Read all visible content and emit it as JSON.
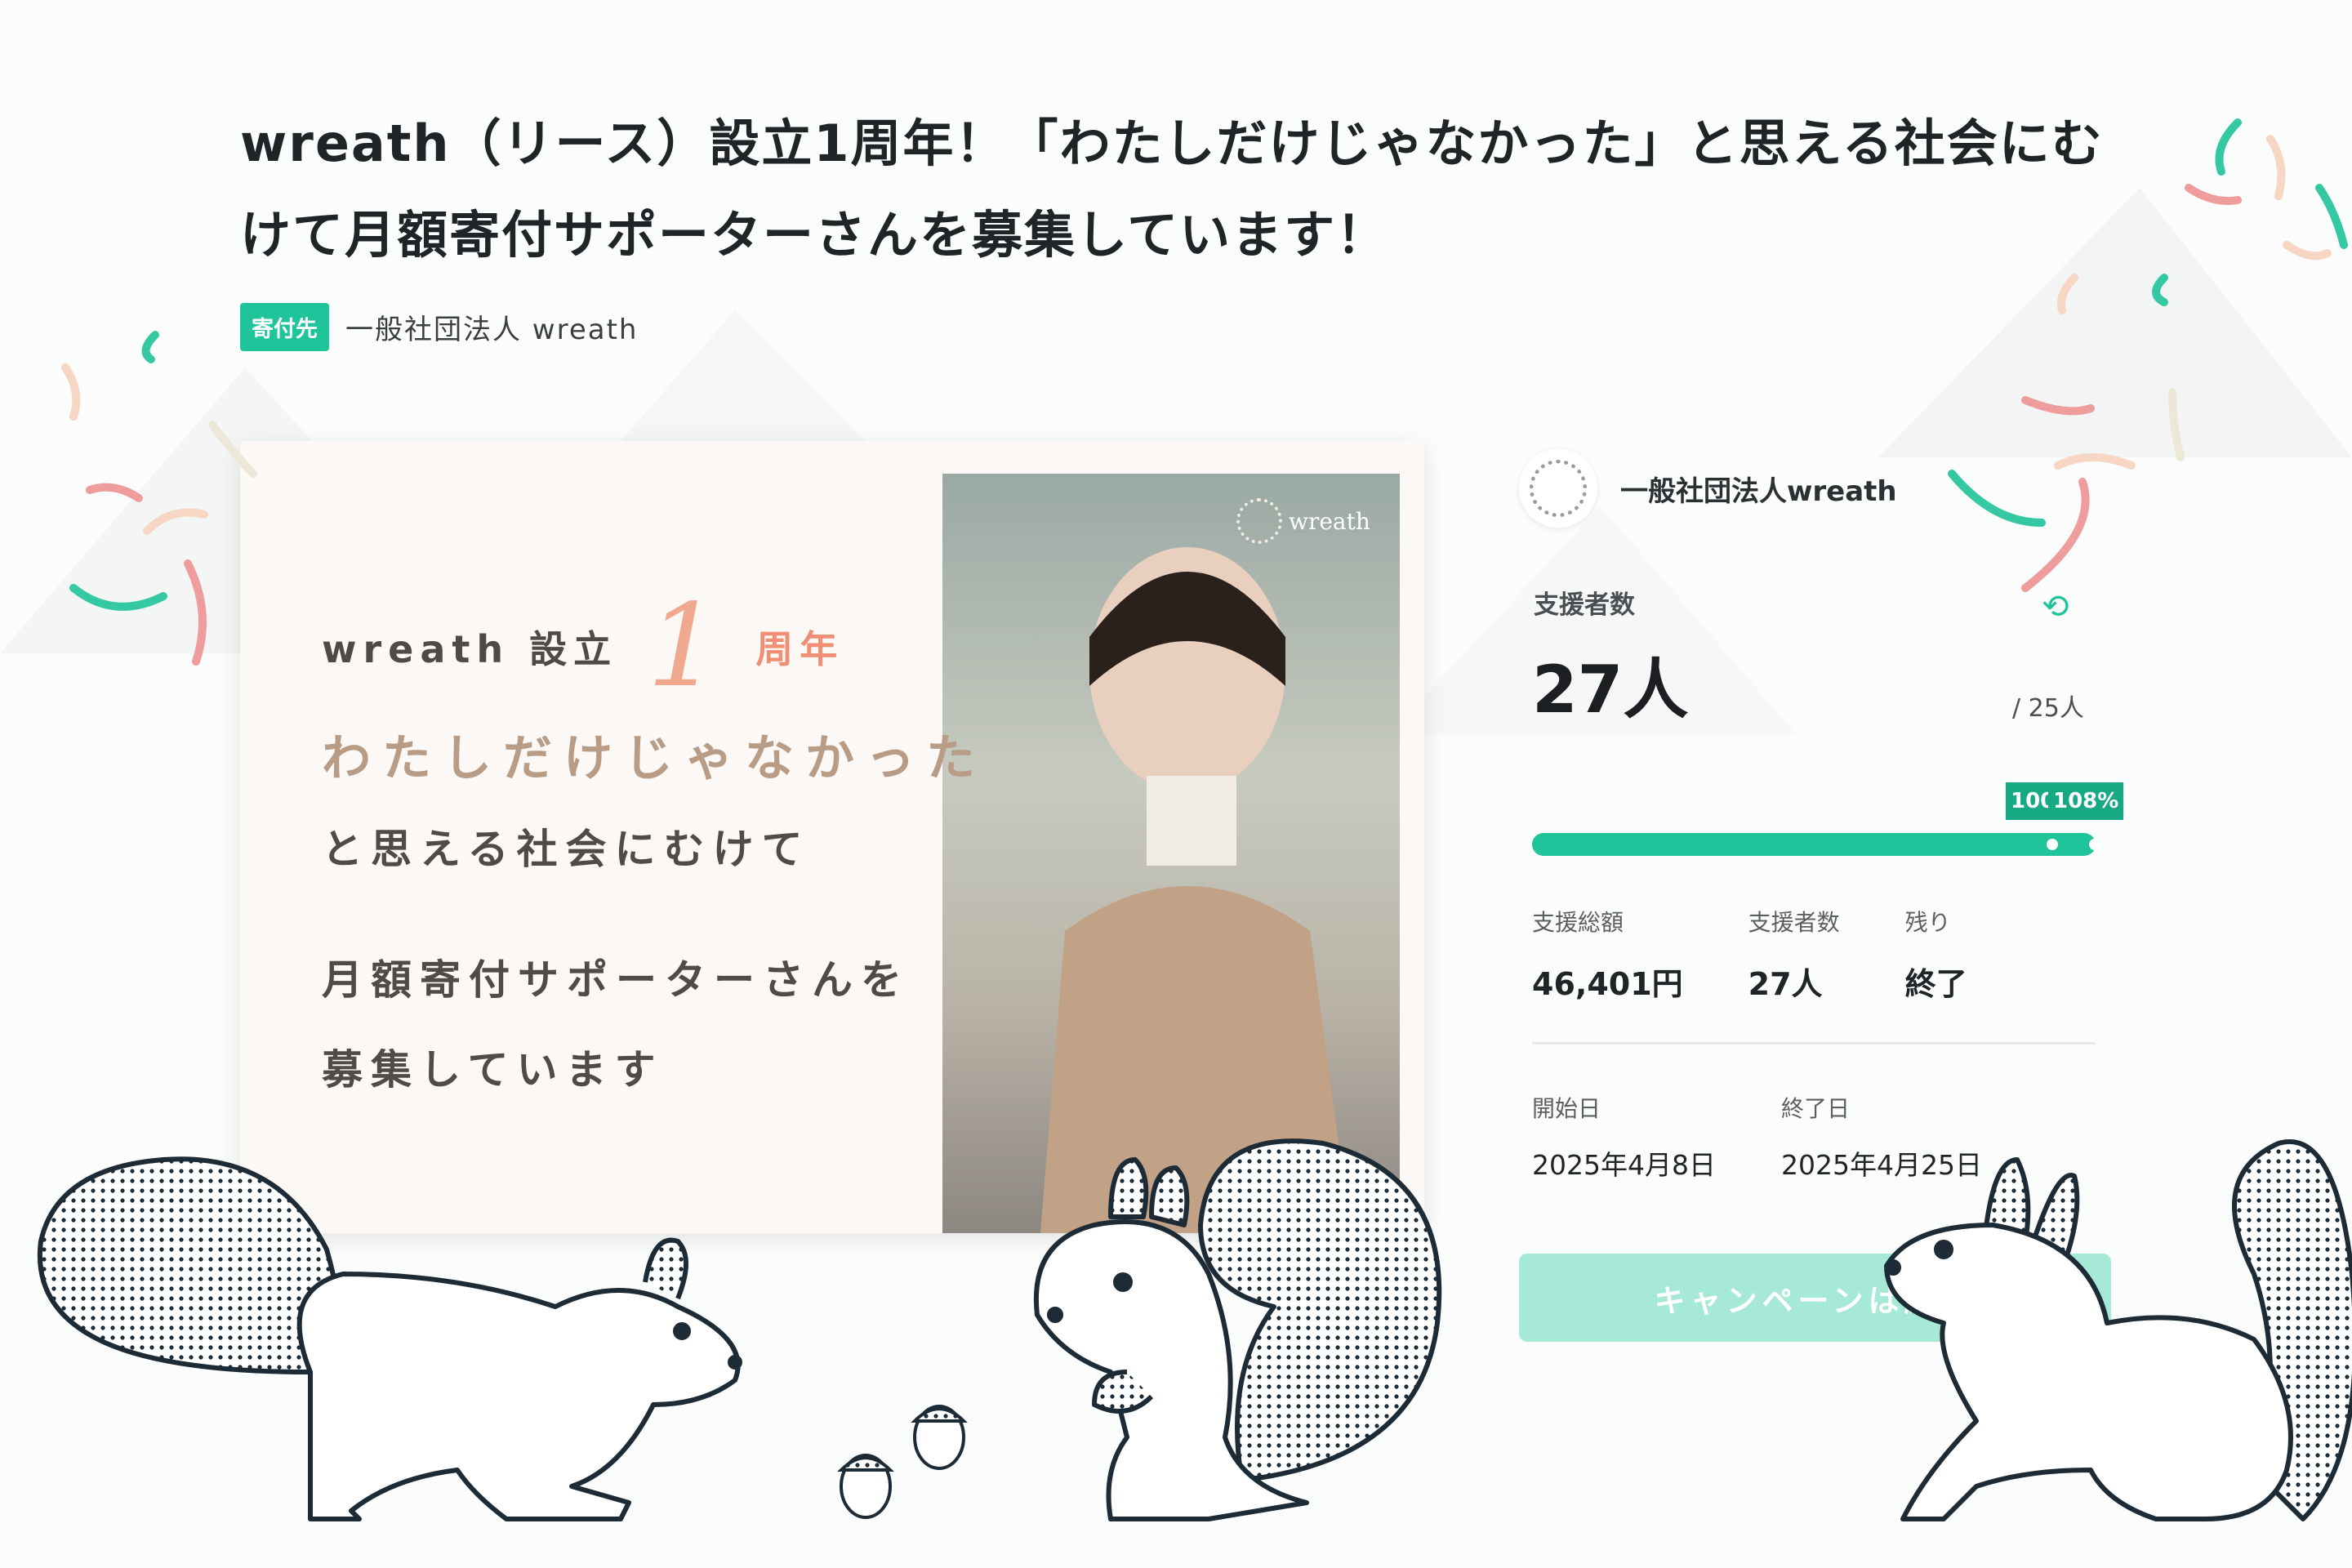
{
  "campaign": {
    "title": "wreath（リース）設立1周年！「わたしだけじゃなかった」と思える社会にむけて月額寄付サポーターさんを募集しています！",
    "recipient_tag": "寄付先",
    "recipient_name": "一般社団法人 wreath"
  },
  "image_card": {
    "brand": "wreath",
    "line1_prefix": "wreath 設立",
    "line1_number": "1",
    "line1_suffix": "周年",
    "line2": "わたしだけじゃなかった",
    "line3": "と思える社会にむけて",
    "line4": "月額寄付サポーターさんを",
    "line5": "募集しています"
  },
  "panel": {
    "org_name": "一般社団法人wreath",
    "supporters_label": "支援者数",
    "supporters_count": "27人",
    "goal": "/ 25人",
    "progress_percent": 108,
    "progress_badge_100": "100",
    "progress_badge": "108%",
    "stats": [
      {
        "label": "支援総額",
        "value": "46,401円"
      },
      {
        "label": "支援者数",
        "value": "27人"
      },
      {
        "label": "残り",
        "value": "終了"
      }
    ],
    "dates": [
      {
        "label": "開始日",
        "value": "2025年4月8日"
      },
      {
        "label": "終了日",
        "value": "2025年4月25日"
      }
    ],
    "end_button": "キャンペーンは終了"
  },
  "colors": {
    "accent": "#1fc49b",
    "accent_dark": "#17a984",
    "button_disabled": "#a6e9d6",
    "peach": "#f08f74"
  },
  "icons": [
    "refresh-icon",
    "org-logo-icon",
    "brand-wreath-icon"
  ]
}
